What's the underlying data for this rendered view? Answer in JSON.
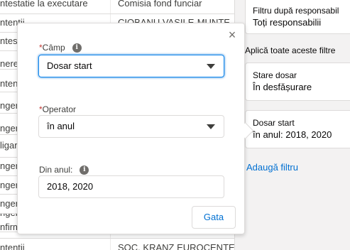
{
  "background_table": {
    "rows": [
      {
        "c1": "ntestatie la executare",
        "c2": "Comisia fond funciar"
      },
      {
        "c1": "ntentii",
        "c2": "CIOBANU VASILE-MUNTE"
      },
      {
        "c1": "ntestatie",
        "c2": ""
      },
      {
        "c1": "nere",
        "c2": ""
      },
      {
        "c1": "ntentii",
        "c2": ""
      },
      {
        "c1": "ngere",
        "c2": ""
      },
      {
        "c1": "ngere",
        "c2": ""
      },
      {
        "c1": "ligare",
        "c2": ""
      },
      {
        "c1": "ngere",
        "c2": ""
      },
      {
        "c1": "ngere",
        "c2": ""
      },
      {
        "c1": "ngere",
        "c2": ""
      },
      {
        "c1": "ngere",
        "c2": ""
      },
      {
        "c1": "nfirm",
        "c2": ""
      },
      {
        "c1": "ntentii",
        "c2": "SOC. KRANZ EUROCENTE"
      }
    ]
  },
  "filter_panel": {
    "responsible": {
      "label": "Filtru după responsabil",
      "value": "Toți responsabilii"
    },
    "apply_all_label": "Aplică toate aceste filtre",
    "status": {
      "label": "Stare dosar",
      "value": "În desfășurare"
    },
    "dosar_start": {
      "label": "Dosar start",
      "value": "în anul: 2018, 2020"
    },
    "add_filter_label": "Adaugă filtru"
  },
  "popover": {
    "close_glyph": "×",
    "field": {
      "required_mark": "*",
      "label": "Câmp",
      "value": "Dosar start"
    },
    "operator": {
      "required_mark": "*",
      "label": "Operator",
      "value": "în anul"
    },
    "year": {
      "label": "Din anul:",
      "value": "2018, 2020"
    },
    "done_label": "Gata"
  },
  "colors": {
    "accent": "#0070d2",
    "focus_border": "#1589ee",
    "required": "#c23934",
    "panel_bg": "#f3f2f2"
  }
}
